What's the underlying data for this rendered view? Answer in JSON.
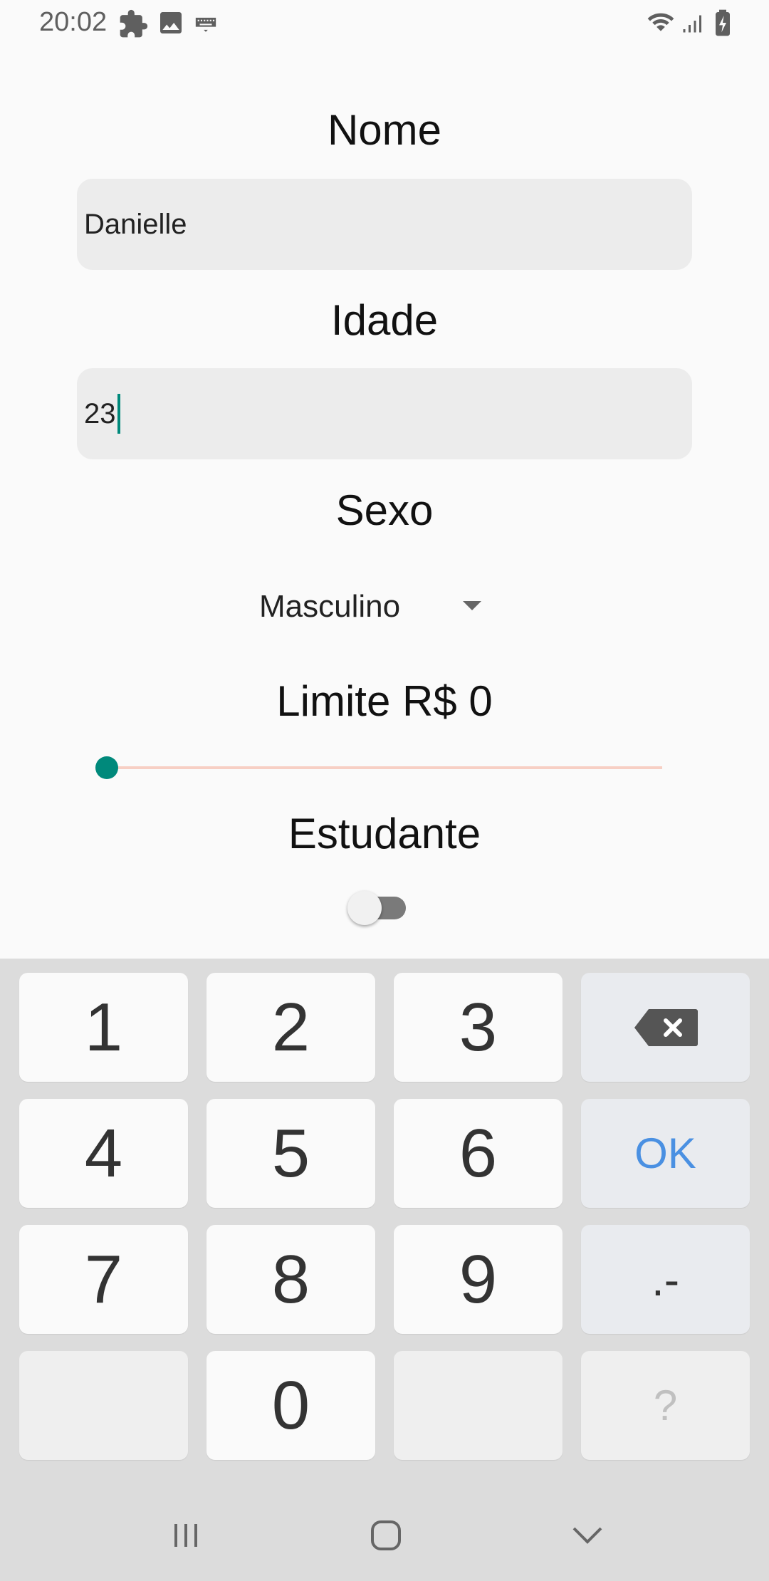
{
  "status_bar": {
    "time": "20:02",
    "icons": [
      "puzzle-icon",
      "image-icon",
      "keyboard-icon",
      "wifi-icon",
      "signal-icon",
      "battery-charging-icon"
    ]
  },
  "form": {
    "nome": {
      "label": "Nome",
      "value": "Danielle"
    },
    "idade": {
      "label": "Idade",
      "value": "23"
    },
    "sexo": {
      "label": "Sexo",
      "selected": "Masculino"
    },
    "limite": {
      "label": "Limite R$ 0",
      "slider_value": 0
    },
    "estudante": {
      "label": "Estudante",
      "checked": false
    }
  },
  "keyboard": {
    "keys": [
      "1",
      "2",
      "3",
      "4",
      "5",
      "6",
      "7",
      "8",
      "9",
      "0"
    ],
    "ok_label": "OK",
    "dot_dash_label": ".-",
    "question_label": "?"
  },
  "colors": {
    "accent": "#00897b",
    "slider_track": "#f7cfc4",
    "ok_blue": "#4a90e2"
  }
}
